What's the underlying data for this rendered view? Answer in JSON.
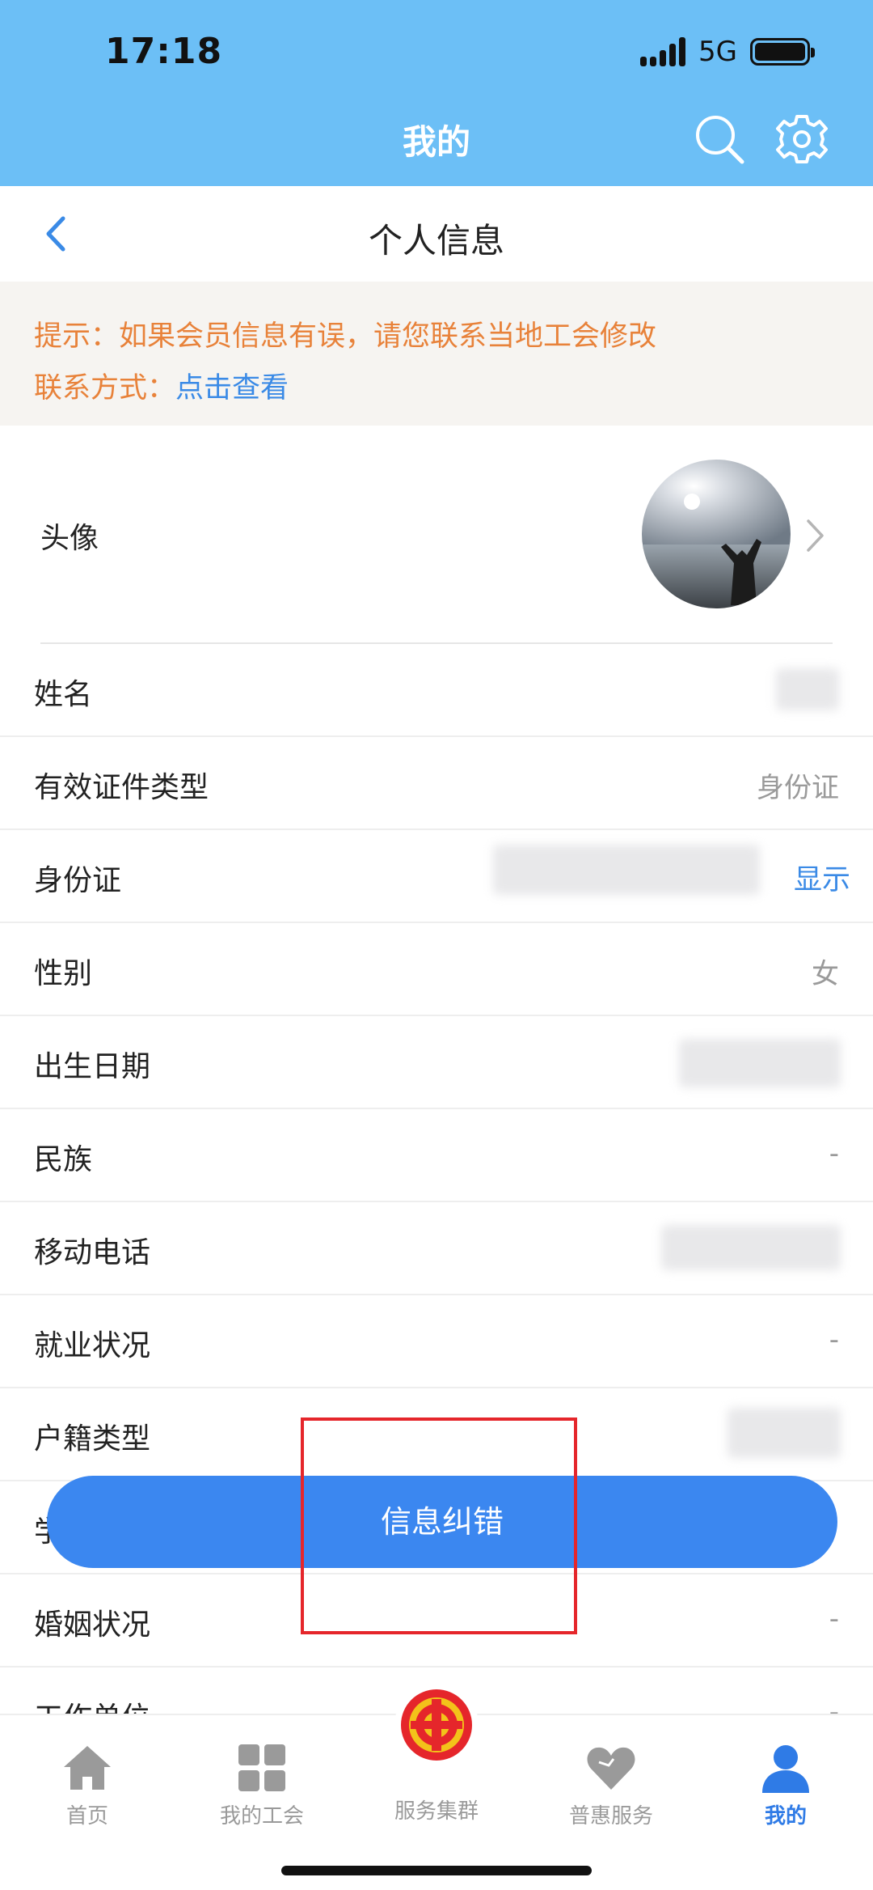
{
  "status": {
    "time": "17:18",
    "network": "5G"
  },
  "header": {
    "title": "我的"
  },
  "subnav": {
    "title": "个人信息"
  },
  "notice": {
    "line1": "提示：如果会员信息有误，请您联系当地工会修改",
    "contact_label": "联系方式：",
    "contact_link": "点击查看"
  },
  "avatar_row": {
    "label": "头像"
  },
  "info_rows": [
    {
      "label": "姓名",
      "value": ""
    },
    {
      "label": "有效证件类型",
      "value": "身份证"
    },
    {
      "label": "身份证",
      "value": "",
      "action": "显示"
    },
    {
      "label": "性别",
      "value": "女"
    },
    {
      "label": "出生日期",
      "value": ""
    },
    {
      "label": "民族",
      "value": "-"
    },
    {
      "label": "移动电话",
      "value": ""
    },
    {
      "label": "就业状况",
      "value": "-"
    },
    {
      "label": "户籍类型",
      "value": ""
    },
    {
      "label": "学",
      "value": ""
    },
    {
      "label": "婚姻状况",
      "value": "-"
    },
    {
      "label": "工作单位",
      "value": "-"
    }
  ],
  "correct_button": {
    "label": "信息纠错"
  },
  "tabs": [
    {
      "label": "首页",
      "icon": "home-icon"
    },
    {
      "label": "我的工会",
      "icon": "grid-icon"
    },
    {
      "label": "服务集群",
      "icon": "union-emblem-icon"
    },
    {
      "label": "普惠服务",
      "icon": "heart-icon"
    },
    {
      "label": "我的",
      "icon": "person-icon",
      "active": true
    }
  ],
  "colors": {
    "header_bg": "#6cbff6",
    "accent": "#3b87f0",
    "notice_text": "#e8823a",
    "link": "#3a8ae6",
    "highlight": "#e5262b"
  }
}
